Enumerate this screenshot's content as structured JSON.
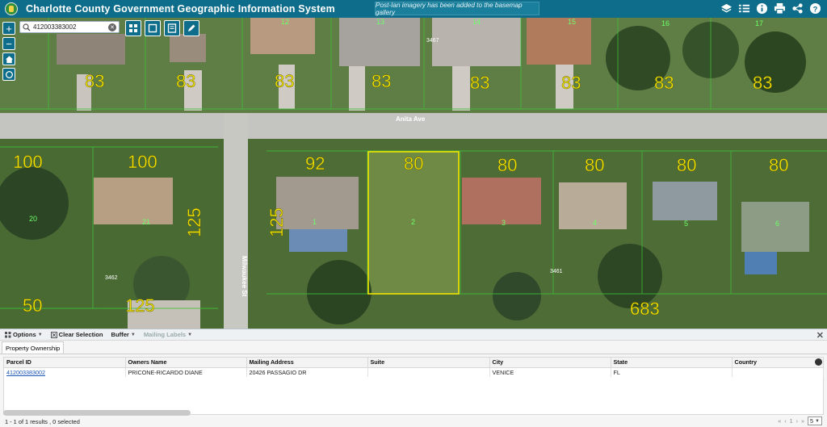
{
  "header": {
    "title": "Charlotte County Government Geographic Information System",
    "notice": "Post-Ian imagery has been added to the basemap gallery",
    "icons": [
      "layers-icon",
      "tasks-icon",
      "info-icon",
      "print-icon",
      "share-icon",
      "help-icon"
    ]
  },
  "search": {
    "value": "412003383002"
  },
  "map": {
    "street_label": "Anita Ave",
    "side_street_label": "Milwaukee St",
    "zone_labels": [
      "83",
      "83",
      "83",
      "83",
      "83",
      "83",
      "83",
      "83",
      "100",
      "100",
      "92",
      "80",
      "80",
      "80",
      "80",
      "80",
      "125",
      "125",
      "50",
      "125",
      "683"
    ],
    "lot_numbers": [
      "12",
      "13",
      "14",
      "15",
      "16",
      "17",
      "20",
      "21",
      "1",
      "2",
      "3",
      "4",
      "5",
      "6"
    ],
    "address_labels": [
      "3467",
      "3462",
      "3461"
    ],
    "selected_parcel_color": "#f0e400"
  },
  "panel": {
    "options_label": "Options",
    "clear_label": "Clear Selection",
    "buffer_label": "Buffer",
    "mailing_label": "Mailing Labels",
    "tab_label": "Property Ownership",
    "columns": [
      "Parcel ID",
      "Owners Name",
      "Mailing Address",
      "Suite",
      "City",
      "State",
      "Country"
    ],
    "rows": [
      [
        "412003383002",
        "PRICONE-RICARDO DIANE",
        "20426 PASSAGIO DR",
        "",
        "VENICE",
        "FL",
        ""
      ]
    ],
    "status": "1 - 1 of 1 results , 0 selected",
    "pager": {
      "page": "1",
      "page_size": "5"
    }
  }
}
